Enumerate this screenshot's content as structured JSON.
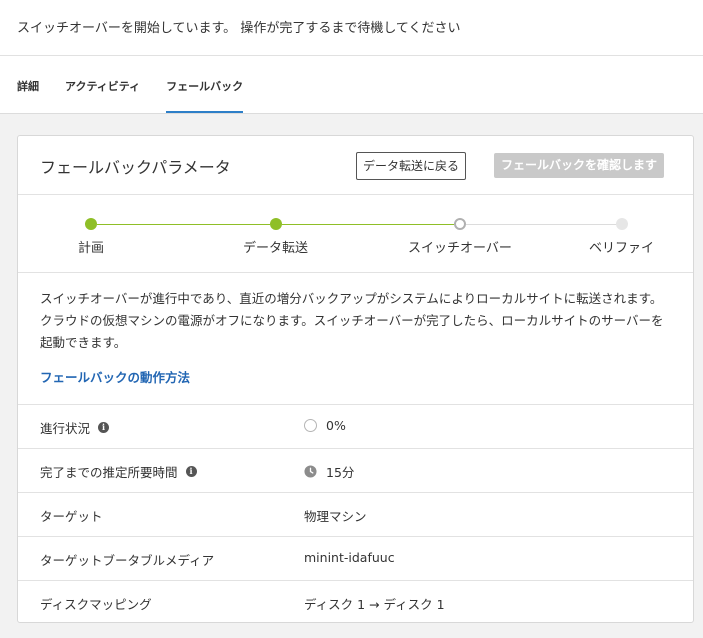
{
  "notice": "スイッチオーバーを開始しています。 操作が完了するまで待機してください",
  "tabs": [
    {
      "label": "詳細"
    },
    {
      "label": "アクティビティ"
    },
    {
      "label": "フェールバック"
    }
  ],
  "panel": {
    "title": "フェールバックパラメータ",
    "back_button": "データ転送に戻る",
    "confirm_button": "フェールバックを確認します"
  },
  "steps": [
    {
      "label": "計画",
      "state": "done"
    },
    {
      "label": "データ転送",
      "state": "done"
    },
    {
      "label": "スイッチオーバー",
      "state": "current"
    },
    {
      "label": "ベリファイ",
      "state": "future"
    }
  ],
  "colors": {
    "done": "#8fbf27",
    "link": "#2266b3",
    "tab_active": "#2d7fc8"
  },
  "description": {
    "text": "スイッチオーバーが進行中であり、直近の増分バックアップがシステムによりローカルサイトに転送されます。クラウドの仮想マシンの電源がオフになります。スイッチオーバーが完了したら、ローカルサイトのサーバーを起動できます。",
    "link": "フェールバックの動作方法"
  },
  "details": [
    {
      "key": "進行状況",
      "value": "0%",
      "info": "i"
    },
    {
      "key": "完了までの推定所要時間",
      "value": "15分",
      "info": "i"
    },
    {
      "key": "ターゲット",
      "value": "物理マシン"
    },
    {
      "key": "ターゲットブータブルメディア",
      "value": "minint-idafuuc"
    },
    {
      "key": "ディスクマッピング",
      "value": "ディスク 1 → ディスク 1"
    }
  ]
}
